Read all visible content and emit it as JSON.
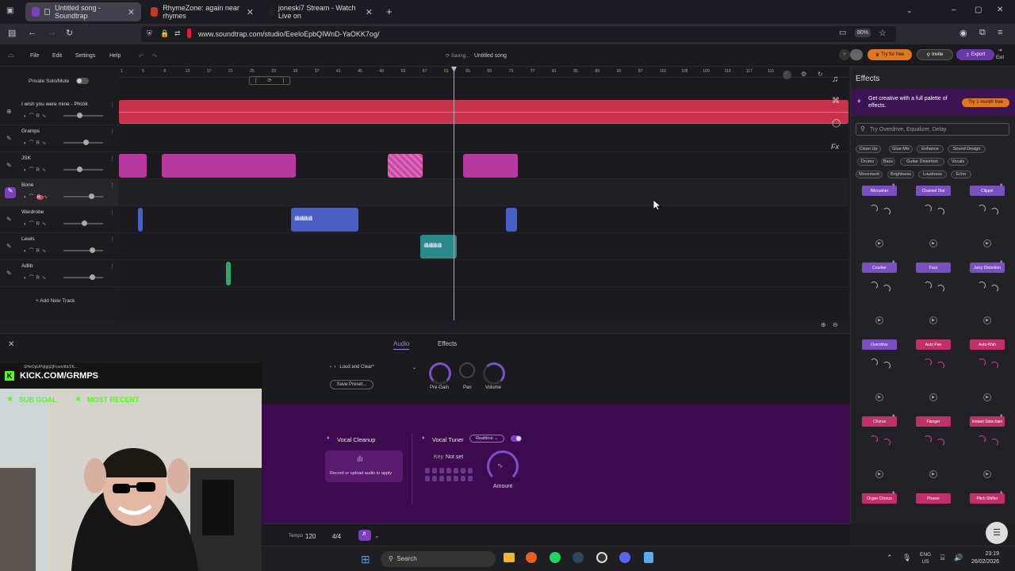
{
  "browser": {
    "tabs": [
      {
        "label": "Untitled song - Soundtrap",
        "active": true
      },
      {
        "label": "RhymeZone: again near rhymes",
        "active": false
      },
      {
        "label": "joneski7 Stream - Watch Live on",
        "active": false
      }
    ],
    "url": "www.soundtrap.com/studio/EeeloEpbQIWnD-YaOKK7og/",
    "zoom": "80%"
  },
  "app": {
    "menu": [
      "File",
      "Edit",
      "Settings",
      "Help"
    ],
    "status": "Saving...",
    "song_title": "Untitled song",
    "try_free": "Try for free",
    "invite": "Invite",
    "export": "Export",
    "exit": "Exit",
    "private_solo_mute": "Private Solo/Mute",
    "add_track": "+ Add New Track"
  },
  "ruler": [
    "1",
    "5",
    "9",
    "13",
    "17",
    "21",
    "25",
    "29",
    "33",
    "37",
    "41",
    "45",
    "49",
    "53",
    "57",
    "61",
    "65",
    "69",
    "73",
    "77",
    "81",
    "85",
    "89",
    "93",
    "97",
    "101",
    "105",
    "109",
    "113",
    "117",
    "121"
  ],
  "tracks": [
    {
      "name": "I wish you were mine - Phizik"
    },
    {
      "name": "Gramps"
    },
    {
      "name": "JSK"
    },
    {
      "name": "Bone"
    },
    {
      "name": "Wardrobe"
    },
    {
      "name": "Lewis"
    },
    {
      "name": "Adlib"
    }
  ],
  "track_controls": "R",
  "effects_panel": {
    "title": "Effects",
    "promo": "Get creative with a full palette of effects.",
    "promo_btn": "Try 1 month free",
    "search_placeholder": "Try Overdrive, Equalizer, Delay",
    "chips": [
      "Clean Up",
      "Glue Mix",
      "Enhance",
      "Sound Design",
      "Drums",
      "Bass",
      "Guitar Distortion",
      "Vocals",
      "Movement",
      "Brightness",
      "Loudness",
      "Echo"
    ],
    "cards": [
      "Bitcrusher",
      "Channel Dist",
      "Clipper",
      "Crusher",
      "Fuzz",
      "Juicy Distortion",
      "Overdrive",
      "Auto Pan",
      "Auto-Wah",
      "Chorus",
      "Flanger",
      "Instant Sidechain",
      "Organ Chorus",
      "Phaser",
      "Pitch Shifter"
    ]
  },
  "editor": {
    "tab_audio": "Audio",
    "tab_effects": "Effects",
    "preset": "Loud and Clear*",
    "save_preset": "Save Preset...",
    "pregain": "Pre-Gain",
    "pan": "Pan",
    "volume": "Volume",
    "vocal_cleanup": "Vocal Cleanup",
    "cleanup_hint": "Record or upload audio to apply",
    "vocal_tuner": "Vocal Tuner",
    "realtime": "Realtime",
    "key": "Key",
    "not_set": "Not set",
    "amount": "Amount"
  },
  "transport": {
    "tempo_label": "Tempo",
    "tempo": "120",
    "meter": "4/4"
  },
  "stream": {
    "handle": "SHeOpUPqIgIjZjFcom/IbI/2K...",
    "kick": "KICK.COM/GRMPS",
    "sub_goal": "SUB GOAL",
    "most_recent": "MOST RECENT"
  },
  "taskbar": {
    "search": "Search",
    "lang": "ENG",
    "region": "US",
    "time": "23:19",
    "date": "26/02/2026"
  },
  "colors": {
    "accent": "#7b3fbf",
    "red_clip": "#c8324a",
    "pink_clip": "#b7389e",
    "blue_clip": "#4a5fc6",
    "teal_clip": "#2a8a8a",
    "green_clip": "#2ea86a",
    "purple_bg": "#3e0a4f"
  }
}
